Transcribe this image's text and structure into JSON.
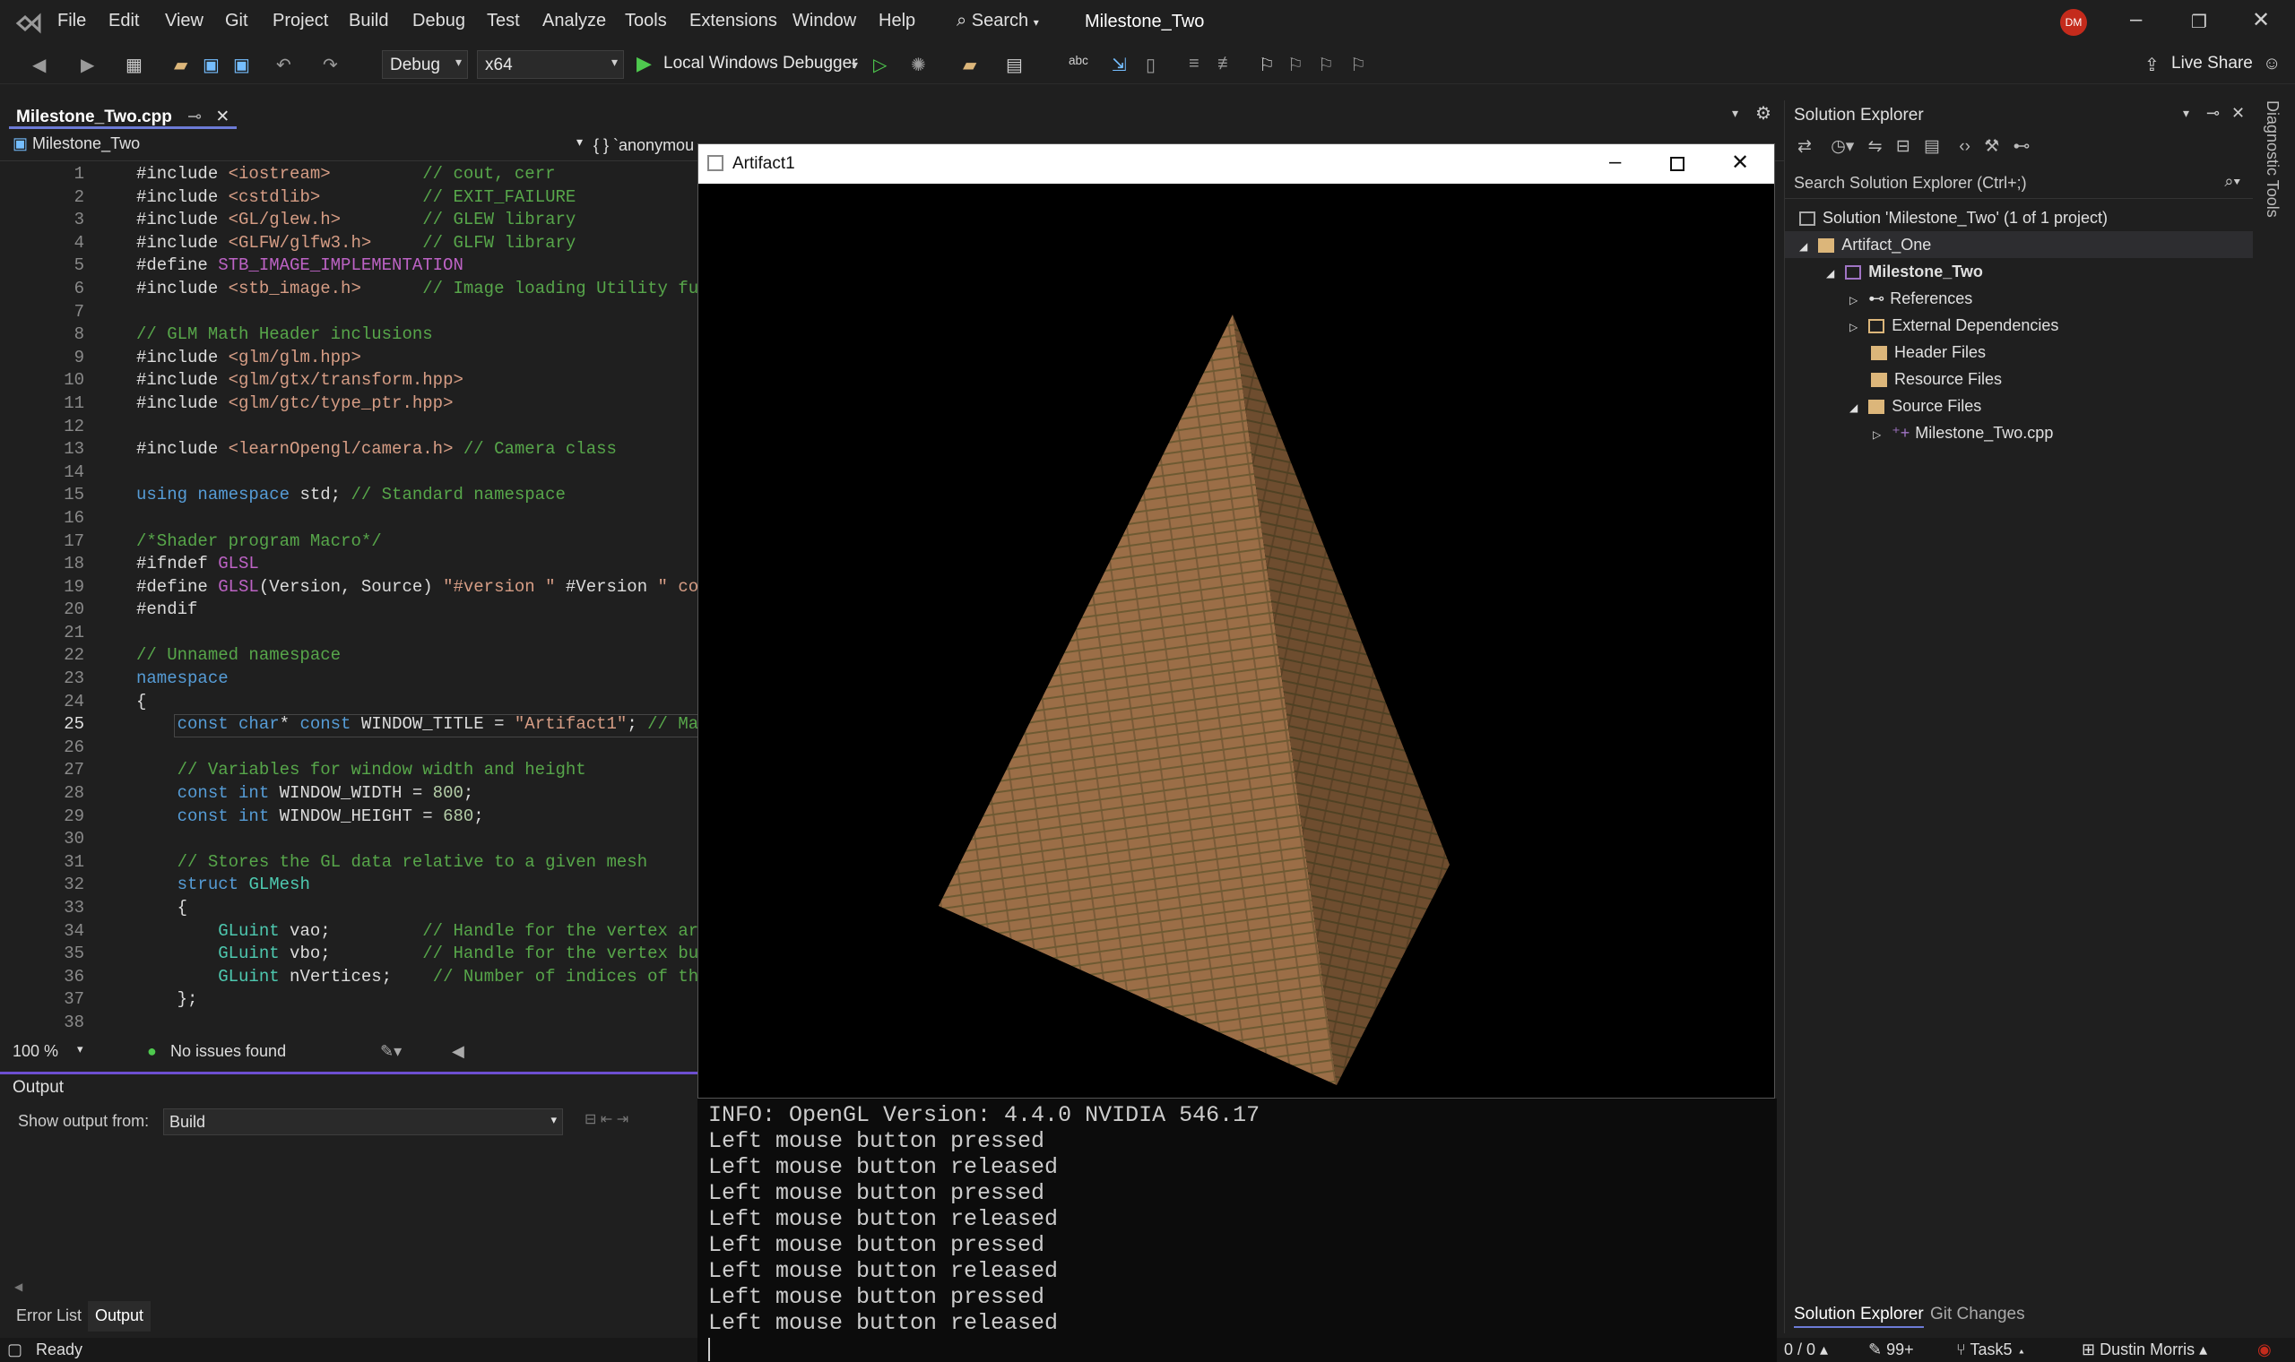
{
  "menubar": {
    "items": [
      "File",
      "Edit",
      "View",
      "Git",
      "Project",
      "Build",
      "Debug",
      "Test",
      "Analyze",
      "Tools",
      "Extensions",
      "Window",
      "Help"
    ],
    "search_label": "Search",
    "title": "Milestone_Two",
    "avatar_initials": "DM"
  },
  "toolbar": {
    "config": "Debug",
    "platform": "x64",
    "debugger": "Local Windows Debugger",
    "live_share": "Live Share"
  },
  "editor": {
    "tab_name": "Milestone_Two.cpp",
    "nav_project": "Milestone_Two",
    "nav_scope": "{ } `anonymou",
    "line_numbers": [
      "1",
      "2",
      "3",
      "4",
      "5",
      "6",
      "7",
      "8",
      "9",
      "10",
      "11",
      "12",
      "13",
      "14",
      "15",
      "16",
      "17",
      "18",
      "19",
      "20",
      "21",
      "22",
      "23",
      "24",
      "25",
      "26",
      "27",
      "28",
      "29",
      "30",
      "31",
      "32",
      "33",
      "34",
      "35",
      "36",
      "37",
      "38"
    ],
    "zoom": "100 %",
    "issues": "No issues found"
  },
  "output": {
    "title": "Output",
    "show_from_label": "Show output from:",
    "source": "Build"
  },
  "bottom_tabs": [
    "Error List",
    "Output"
  ],
  "status": {
    "ready": "Ready",
    "errors": "0 / 0",
    "changes": "99+",
    "branch": "Task5",
    "user": "Dustin Morris"
  },
  "solution_explorer": {
    "title": "Solution Explorer",
    "search_placeholder": "Search Solution Explorer (Ctrl+;)",
    "tree": [
      {
        "label": "Solution 'Milestone_Two' (1 of 1 project)"
      },
      {
        "label": "Artifact_One"
      },
      {
        "label": "Milestone_Two"
      },
      {
        "label": "References"
      },
      {
        "label": "External Dependencies"
      },
      {
        "label": "Header Files"
      },
      {
        "label": "Resource Files"
      },
      {
        "label": "Source Files"
      },
      {
        "label": "Milestone_Two.cpp"
      }
    ],
    "bottom_tabs": [
      "Solution Explorer",
      "Git Changes"
    ],
    "side_tab": "Diagnostic Tools"
  },
  "gl_window": {
    "title": "Artifact1"
  },
  "console": {
    "lines": [
      "INFO: OpenGL Version: 4.4.0 NVIDIA 546.17",
      "Left mouse button pressed",
      "Left mouse button released",
      "Left mouse button pressed",
      "Left mouse button released",
      "Left mouse button pressed",
      "Left mouse button released",
      "Left mouse button pressed",
      "Left mouse button released"
    ]
  },
  "colors": {
    "accent": "#6d7bd6",
    "background": "#1f1f1f",
    "pyramid_light": "#9b6e47",
    "pyramid_dark": "#6e4a2c"
  }
}
